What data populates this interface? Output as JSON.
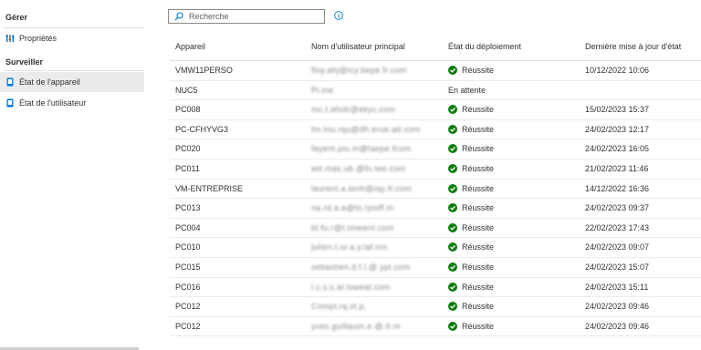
{
  "sidebar": {
    "manage_heading": "Gérer",
    "properties_label": "Propriétés",
    "monitor_heading": "Surveiller",
    "device_status_label": "État de l'appareil",
    "user_status_label": "État de l'utilisateur"
  },
  "search": {
    "placeholder": "Recherche"
  },
  "table": {
    "columns": [
      "Appareil",
      "Nom d'utilisateur principal",
      "État du déploiement",
      "Dernière mise à jour d'état"
    ],
    "rows": [
      {
        "device": "VMW11PERSO",
        "user": "floy.ahj@tcy.bepe.fr.com",
        "status": "Réussite",
        "updated": "10/12/2022 10:06"
      },
      {
        "device": "NUC5",
        "user": "Pi.me",
        "status": "En attente",
        "updated": ""
      },
      {
        "device": "PC008",
        "user": "mc.t.afsdr@ekyc.com",
        "status": "Réussite",
        "updated": "15/02/2023 15:37"
      },
      {
        "device": "PC-CFHYVG3",
        "user": "fm.lnu.rqu@dfr.erue.atr.com",
        "status": "Réussite",
        "updated": "24/02/2023 12:17"
      },
      {
        "device": "PC020",
        "user": "fayent.piu.m@taepe.fcom",
        "status": "Réussite",
        "updated": "24/02/2023 16:05"
      },
      {
        "device": "PC011",
        "user": "wd.mas.ub.@fn.tee.com",
        "status": "Réussite",
        "updated": "21/02/2023 11:46"
      },
      {
        "device": "VM-ENTREPRISE",
        "user": "laurent.a.tenh@isp.fr.com",
        "status": "Réussite",
        "updated": "14/12/2022 16:36"
      },
      {
        "device": "PC013",
        "user": "na.rd.a.a@to.rpsiff.m",
        "status": "Réussite",
        "updated": "24/02/2023 09:37"
      },
      {
        "device": "PC004",
        "user": "bl.fu.r@t.tmewnl.com",
        "status": "Réussite",
        "updated": "22/02/2023 17:43"
      },
      {
        "device": "PC010",
        "user": "julien.t.ur.a.y.laf.om",
        "status": "Réussite",
        "updated": "24/02/2023 09:07"
      },
      {
        "device": "PC015",
        "user": "sebastien.d.f.l.@.ypt.com",
        "status": "Réussite",
        "updated": "24/02/2023 15:07"
      },
      {
        "device": "PC016",
        "user": "l.c.s.s.ar.lsweat.com",
        "status": "Réussite",
        "updated": "24/02/2023 15:11"
      },
      {
        "device": "PC012",
        "user": "Compt.rq.st.p.",
        "status": "Réussite",
        "updated": "24/02/2023 09:46"
      },
      {
        "device": "PC012",
        "user": "yves.guillaum.e.@.fr.m",
        "status": "Réussite",
        "updated": "24/02/2023 09:46"
      }
    ]
  },
  "colors": {
    "success": "#107c10",
    "accent": "#0078d4",
    "selected_bg": "#ebebeb"
  }
}
